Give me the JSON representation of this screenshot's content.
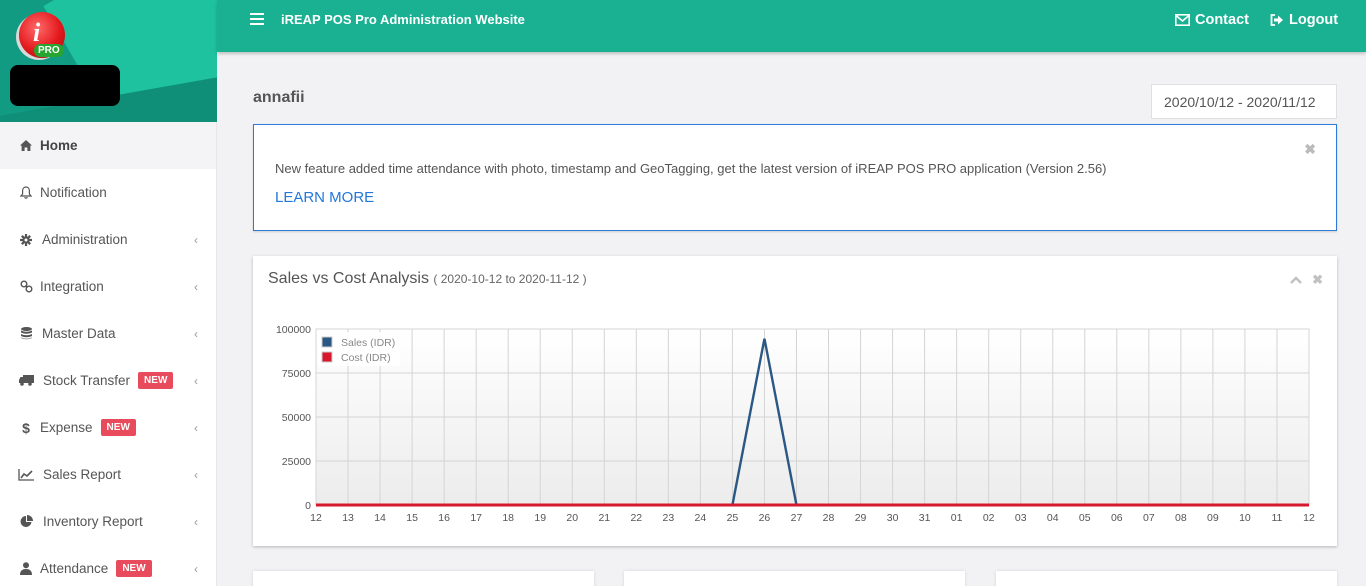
{
  "app": {
    "title": "iREAP POS Pro Administration Website",
    "logo_badge": "PRO",
    "logo_letter": "i"
  },
  "topbar": {
    "menu_icon": "hamburger-icon",
    "contact_label": "Contact",
    "contact_icon": "envelope-icon",
    "logout_label": "Logout",
    "logout_icon": "sign-out-icon"
  },
  "sidebar": {
    "items": [
      {
        "label": "Home",
        "icon": "home-icon",
        "active": true,
        "badge": null,
        "has_submenu": false
      },
      {
        "label": "Notification",
        "icon": "bell-icon",
        "active": false,
        "badge": null,
        "has_submenu": false
      },
      {
        "label": "Administration",
        "icon": "gear-icon",
        "active": false,
        "badge": null,
        "has_submenu": true
      },
      {
        "label": "Integration",
        "icon": "link-icon",
        "active": false,
        "badge": null,
        "has_submenu": true
      },
      {
        "label": "Master Data",
        "icon": "database-icon",
        "active": false,
        "badge": null,
        "has_submenu": true
      },
      {
        "label": "Stock Transfer",
        "icon": "truck-icon",
        "active": false,
        "badge": "NEW",
        "has_submenu": true
      },
      {
        "label": "Expense",
        "icon": "dollar-icon",
        "active": false,
        "badge": "NEW",
        "has_submenu": true
      },
      {
        "label": "Sales Report",
        "icon": "line-chart-icon",
        "active": false,
        "badge": null,
        "has_submenu": true
      },
      {
        "label": "Inventory Report",
        "icon": "pie-chart-icon",
        "active": false,
        "badge": null,
        "has_submenu": true
      },
      {
        "label": "Attendance",
        "icon": "user-icon",
        "active": false,
        "badge": "NEW",
        "has_submenu": true
      }
    ],
    "chevron": "‹"
  },
  "main": {
    "username": "annafii",
    "date_range": "2020/10/12 - 2020/11/12",
    "alert": {
      "text": "New feature added time attendance with photo, timestamp and GeoTagging, get the latest version of iREAP POS PRO application (Version 2.56)",
      "link_label": "LEARN MORE",
      "close_symbol": "✖"
    },
    "chart_card": {
      "title": "Sales vs Cost Analysis",
      "subtitle": "( 2020-10-12 to 2020-11-12 )",
      "collapse_symbol": "^",
      "close_symbol": "✖"
    }
  },
  "colors": {
    "brand": "#1ab193",
    "sales": "#2a5783",
    "cost": "#d7172d",
    "link": "#2277d8",
    "badge": "#e84b5c"
  },
  "chart_data": {
    "type": "line",
    "title": "Sales vs Cost Analysis",
    "subtitle": "( 2020-10-12 to 2020-11-12 )",
    "xlabel": "",
    "ylabel": "",
    "ylim": [
      0,
      100000
    ],
    "yticks": [
      "0",
      "25000",
      "50000",
      "75000",
      "100000"
    ],
    "ytick_values": [
      0,
      25000,
      50000,
      75000,
      100000
    ],
    "x": [
      "12",
      "13",
      "14",
      "15",
      "16",
      "17",
      "18",
      "19",
      "20",
      "21",
      "22",
      "23",
      "24",
      "25",
      "26",
      "27",
      "28",
      "29",
      "30",
      "31",
      "01",
      "02",
      "03",
      "04",
      "05",
      "06",
      "07",
      "08",
      "09",
      "10",
      "11",
      "12"
    ],
    "grid": true,
    "legend_position": "top-left",
    "series": [
      {
        "name": "Sales (IDR)",
        "color": "#2a5783",
        "values": [
          0,
          0,
          0,
          0,
          0,
          0,
          0,
          0,
          0,
          0,
          0,
          0,
          0,
          0,
          94500,
          0,
          0,
          0,
          0,
          0,
          0,
          0,
          0,
          0,
          0,
          0,
          0,
          0,
          0,
          0,
          0,
          0
        ]
      },
      {
        "name": "Cost (IDR)",
        "color": "#d7172d",
        "values": [
          0,
          0,
          0,
          0,
          0,
          0,
          0,
          0,
          0,
          0,
          0,
          0,
          0,
          0,
          0,
          0,
          0,
          0,
          0,
          0,
          0,
          0,
          0,
          0,
          0,
          0,
          0,
          0,
          0,
          0,
          0,
          0
        ]
      }
    ]
  }
}
